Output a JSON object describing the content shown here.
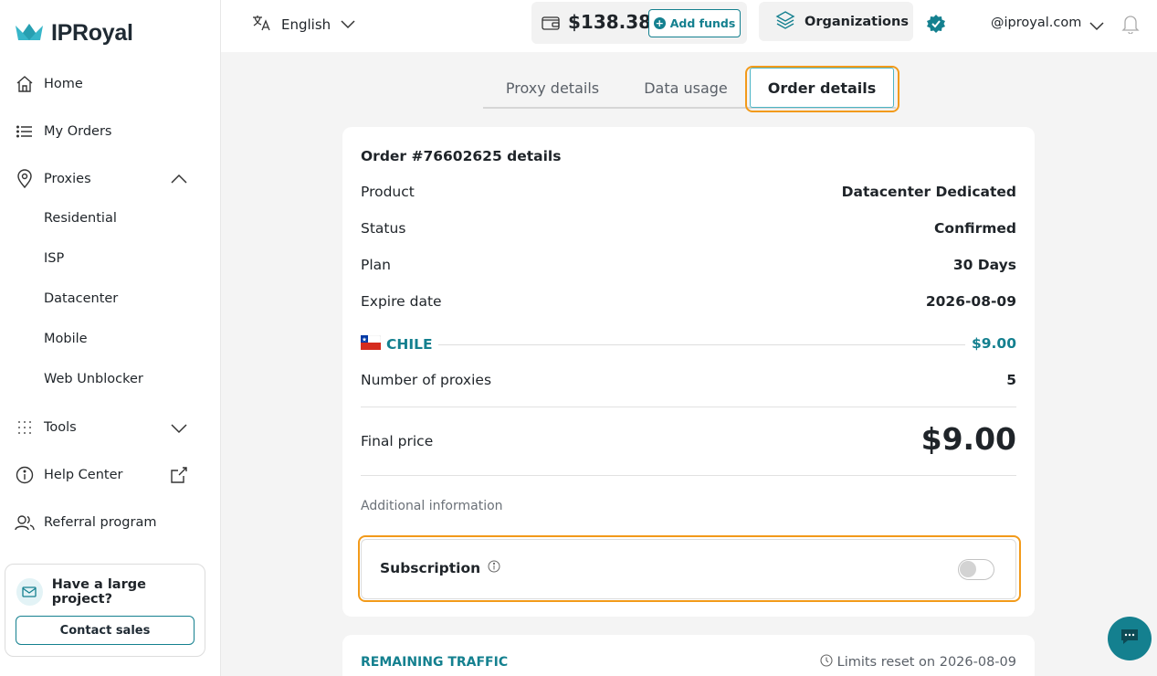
{
  "brand": {
    "name": "IPRoyal",
    "accent": "#14808f",
    "highlight": "#f29a1a"
  },
  "sidebar": {
    "items": [
      {
        "label": "Home",
        "icon": "home-icon"
      },
      {
        "label": "My Orders",
        "icon": "list-icon"
      },
      {
        "label": "Proxies",
        "icon": "location-pin-icon",
        "expanded": true
      },
      {
        "label": "Tools",
        "icon": "grid-dots-icon",
        "expanded": false
      },
      {
        "label": "Help Center",
        "icon": "info-icon"
      },
      {
        "label": "Referral program",
        "icon": "users-icon"
      }
    ],
    "proxy_subitems": [
      "Residential",
      "ISP",
      "Datacenter",
      "Mobile",
      "Web Unblocker"
    ],
    "promo": {
      "title": "Have a large project?",
      "button": "Contact sales"
    }
  },
  "topbar": {
    "language": "English",
    "balance": "$138.38",
    "add_funds": "Add funds",
    "organizations": "Organizations",
    "email": "@iproyal.com"
  },
  "tabs": [
    {
      "label": "Proxy details",
      "active": false
    },
    {
      "label": "Data usage",
      "active": false
    },
    {
      "label": "Order details",
      "active": true
    }
  ],
  "order": {
    "title": "Order #76602625 details",
    "rows": [
      {
        "label": "Product",
        "value": "Datacenter Dedicated"
      },
      {
        "label": "Status",
        "value": "Confirmed"
      },
      {
        "label": "Plan",
        "value": "30 Days"
      },
      {
        "label": "Expire date",
        "value": "2026-08-09"
      }
    ],
    "country": {
      "name": "CHILE",
      "price": "$9.00"
    },
    "proxies": {
      "label": "Number of proxies",
      "value": "5"
    },
    "final": {
      "label": "Final price",
      "value": "$9.00"
    },
    "additional_info": "Additional information",
    "subscription": {
      "label": "Subscription",
      "enabled": false
    }
  },
  "traffic": {
    "title": "REMAINING TRAFFIC",
    "reset": "Limits reset on 2026-08-09"
  }
}
